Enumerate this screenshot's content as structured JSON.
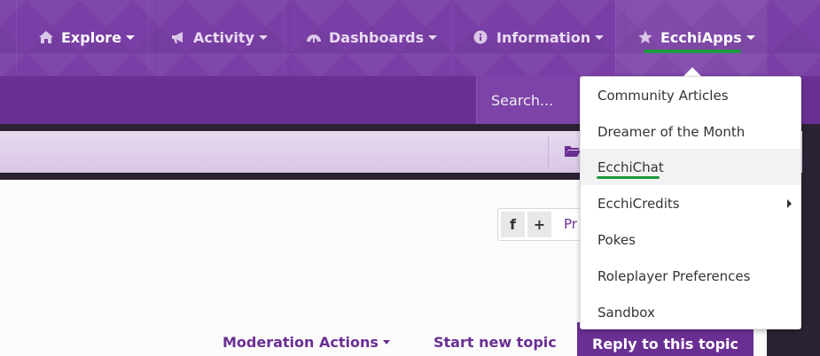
{
  "nav": {
    "items": [
      {
        "label": "Explore",
        "icon": "home-icon"
      },
      {
        "label": "Activity",
        "icon": "megaphone-icon"
      },
      {
        "label": "Dashboards",
        "icon": "dashboard-icon"
      },
      {
        "label": "Information",
        "icon": "info-icon"
      },
      {
        "label": "EcchiApps",
        "icon": "star-icon"
      }
    ]
  },
  "search": {
    "placeholder": "Search..."
  },
  "share": {
    "facebook": "f",
    "plus": "+",
    "label": "Pr"
  },
  "actions": {
    "moderation": "Moderation Actions",
    "start_topic": "Start new topic",
    "reply": "Reply to this topic"
  },
  "dropdown": {
    "items": [
      {
        "label": "Community Articles"
      },
      {
        "label": "Dreamer of the Month"
      },
      {
        "label": "EcchiChat"
      },
      {
        "label": "EcchiCredits"
      },
      {
        "label": "Pokes"
      },
      {
        "label": "Roleplayer Preferences"
      },
      {
        "label": "Sandbox"
      }
    ]
  },
  "colors": {
    "brand": "#7a3fa6",
    "accent_underline": "#1f9a3e",
    "button": "#6a2f93"
  }
}
